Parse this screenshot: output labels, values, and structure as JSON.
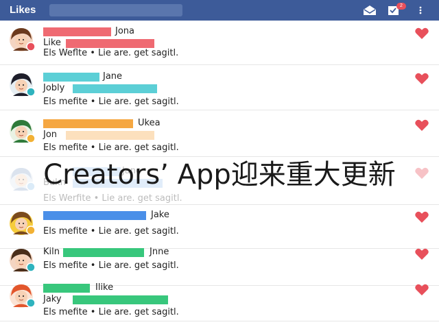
{
  "header": {
    "title": "Likes",
    "notification_count": "2",
    "bg_color": "#3d5b99"
  },
  "feed": [
    {
      "name": "Jona",
      "subname": "Like",
      "caption": "Els Weflte • Lie are. get sagitl.",
      "bar1_color": "#ef6a72",
      "bar2_color": "#ef6a72",
      "avatar_bg": "#f4d5c2",
      "hair_color": "#6b3a1e",
      "badge_color": "#e8505b",
      "faded": false
    },
    {
      "name": "Jane",
      "subname": "Jobly",
      "caption": "Els mefite • Lie are. get sagitl.",
      "bar1_color": "#5ccfd6",
      "bar2_color": "#5ccfd6",
      "avatar_bg": "#e6eef2",
      "hair_color": "#1e1e2a",
      "badge_color": "#2fb3be",
      "faded": false
    },
    {
      "name": "Ukea",
      "subname": "Jon",
      "caption": "Els mefite • Lie are. get sagitl.",
      "bar1_color": "#f5a742",
      "bar2_color": "#f5a742",
      "avatar_bg": "#e9f2e4",
      "hair_color": "#2f7a3a",
      "badge_color": "#f2b134",
      "faded": false
    },
    {
      "name": "Jane",
      "subname": "Bukn",
      "caption": "Els Werfite • Lie are. get sagitl.",
      "bar1_color": "#9bc3f0",
      "bar2_color": "#9bc3f0",
      "avatar_bg": "#dde6f0",
      "hair_color": "#8aa5c8",
      "badge_color": "#8cc0ea",
      "faded": true
    },
    {
      "name": "Jake",
      "subname": "",
      "caption": "Els mefite • Lie are. get sagitl.",
      "bar1_color": "#4a8fe8",
      "bar2_color": "#4a8fe8",
      "avatar_bg": "#f6cc3c",
      "hair_color": "#7a4a1e",
      "badge_color": "#f2b134",
      "faded": false
    },
    {
      "name": "Jnne",
      "subname": "Kiln",
      "caption": "Els mefite • Lie are. get sagitl.",
      "bar1_color": "#38c77c",
      "bar2_color": "#38c77c",
      "avatar_bg": "#f4d5c2",
      "hair_color": "#4a2e1a",
      "badge_color": "#2fb3be",
      "faded": false
    },
    {
      "name": "Ilike",
      "subname": "Jaky",
      "caption": "Els mefite • Lie are. get sagitl.",
      "bar1_color": "#38c77c",
      "bar2_color": "#38c77c",
      "avatar_bg": "#fbe3d4",
      "hair_color": "#e2562c",
      "badge_color": "#2fb3be",
      "faded": false
    }
  ],
  "overlay_title": "Creators’ App迎来重大更新",
  "colors": {
    "heart": "#e8505b",
    "heart_faded": "#f7c2c6"
  },
  "icons": [
    "mail-icon",
    "notification-icon",
    "more-icon",
    "heart-icon"
  ]
}
